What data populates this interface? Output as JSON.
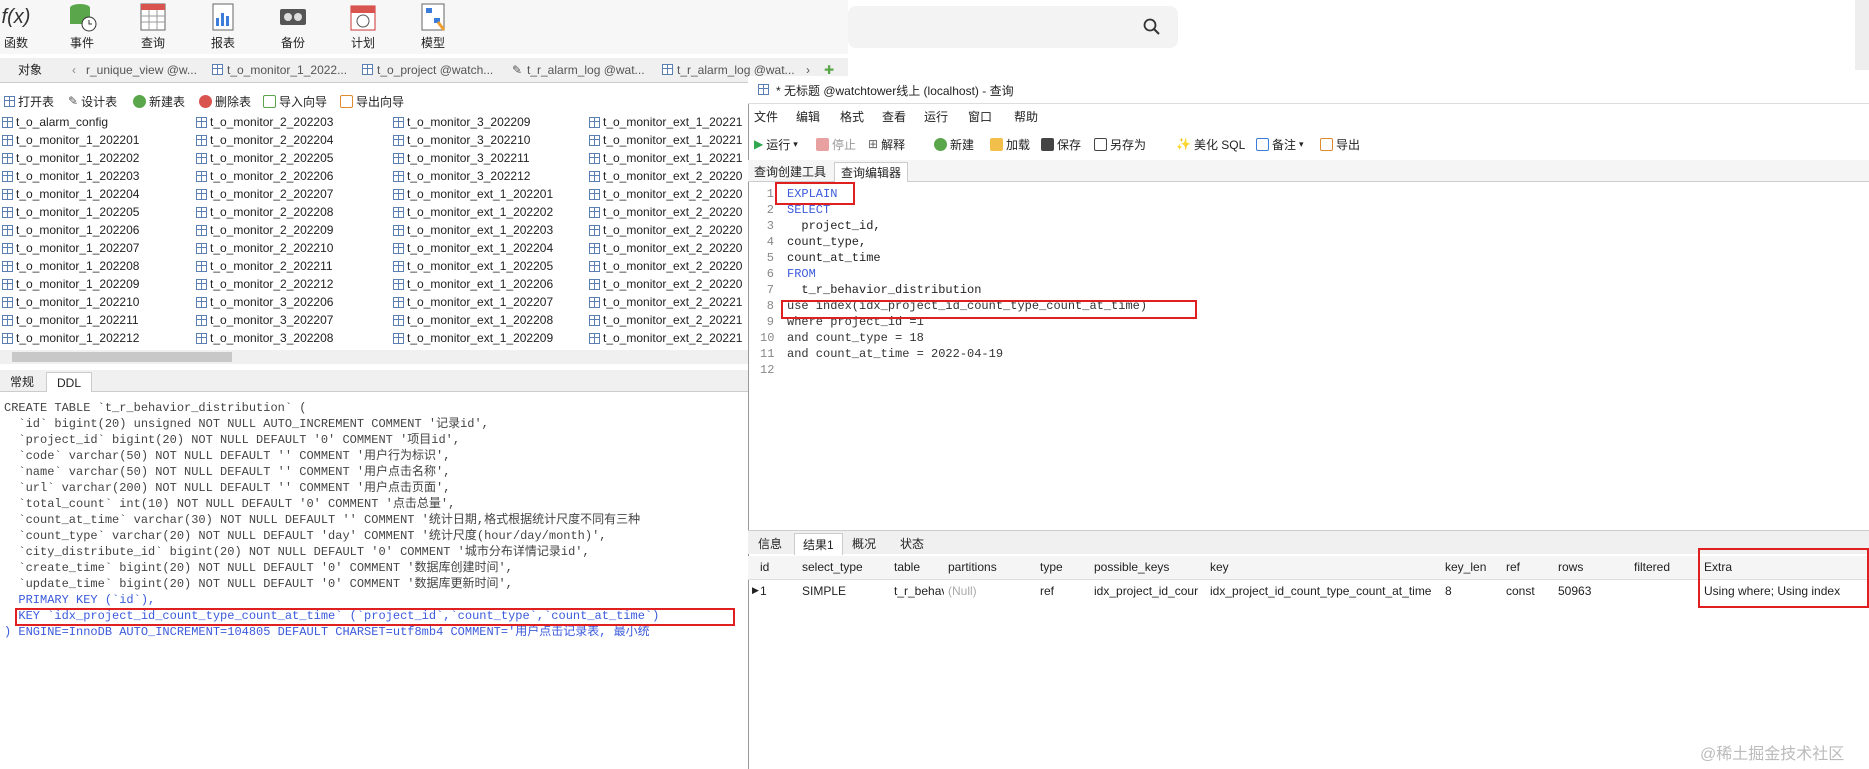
{
  "toolbar": {
    "items": [
      "函数",
      "事件",
      "查询",
      "报表",
      "备份",
      "计划",
      "模型"
    ]
  },
  "left_tabs": {
    "objects": "对象",
    "tabs": [
      "r_unique_view @w...",
      "t_o_monitor_1_2022...",
      "t_o_project @watch...",
      "t_r_alarm_log @wat...",
      "t_r_alarm_log @wat..."
    ]
  },
  "obj_toolbar": [
    "打开表",
    "设计表",
    "新建表",
    "删除表",
    "导入向导",
    "导出向导"
  ],
  "tables": {
    "col1": [
      "t_o_alarm_config",
      "t_o_monitor_1_202201",
      "t_o_monitor_1_202202",
      "t_o_monitor_1_202203",
      "t_o_monitor_1_202204",
      "t_o_monitor_1_202205",
      "t_o_monitor_1_202206",
      "t_o_monitor_1_202207",
      "t_o_monitor_1_202208",
      "t_o_monitor_1_202209",
      "t_o_monitor_1_202210",
      "t_o_monitor_1_202211",
      "t_o_monitor_1_202212"
    ],
    "col2": [
      "t_o_monitor_2_202203",
      "t_o_monitor_2_202204",
      "t_o_monitor_2_202205",
      "t_o_monitor_2_202206",
      "t_o_monitor_2_202207",
      "t_o_monitor_2_202208",
      "t_o_monitor_2_202209",
      "t_o_monitor_2_202210",
      "t_o_monitor_2_202211",
      "t_o_monitor_2_202212",
      "t_o_monitor_3_202206",
      "t_o_monitor_3_202207",
      "t_o_monitor_3_202208"
    ],
    "col3": [
      "t_o_monitor_3_202209",
      "t_o_monitor_3_202210",
      "t_o_monitor_3_202211",
      "t_o_monitor_3_202212",
      "t_o_monitor_ext_1_202201",
      "t_o_monitor_ext_1_202202",
      "t_o_monitor_ext_1_202203",
      "t_o_monitor_ext_1_202204",
      "t_o_monitor_ext_1_202205",
      "t_o_monitor_ext_1_202206",
      "t_o_monitor_ext_1_202207",
      "t_o_monitor_ext_1_202208",
      "t_o_monitor_ext_1_202209"
    ],
    "col4": [
      "t_o_monitor_ext_1_20221",
      "t_o_monitor_ext_1_20221",
      "t_o_monitor_ext_1_20221",
      "t_o_monitor_ext_2_20220",
      "t_o_monitor_ext_2_20220",
      "t_o_monitor_ext_2_20220",
      "t_o_monitor_ext_2_20220",
      "t_o_monitor_ext_2_20220",
      "t_o_monitor_ext_2_20220",
      "t_o_monitor_ext_2_20220",
      "t_o_monitor_ext_2_20221",
      "t_o_monitor_ext_2_20221",
      "t_o_monitor_ext_2_20221"
    ]
  },
  "ddl_tabs": [
    "常规",
    "DDL"
  ],
  "ddl_lines": [
    "CREATE TABLE `t_r_behavior_distribution` (",
    "  `id` bigint(20) unsigned NOT NULL AUTO_INCREMENT COMMENT '记录id',",
    "  `project_id` bigint(20) NOT NULL DEFAULT '0' COMMENT '项目id',",
    "  `code` varchar(50) NOT NULL DEFAULT '' COMMENT '用户行为标识',",
    "  `name` varchar(50) NOT NULL DEFAULT '' COMMENT '用户点击名称',",
    "  `url` varchar(200) NOT NULL DEFAULT '' COMMENT '用户点击页面',",
    "  `total_count` int(10) NOT NULL DEFAULT '0' COMMENT '点击总量',",
    "  `count_at_time` varchar(30) NOT NULL DEFAULT '' COMMENT '统计日期,格式根据统计尺度不同有三种",
    "  `count_type` varchar(20) NOT NULL DEFAULT 'day' COMMENT '统计尺度(hour/day/month)',",
    "  `city_distribute_id` bigint(20) NOT NULL DEFAULT '0' COMMENT '城市分布详情记录id',",
    "  `create_time` bigint(20) NOT NULL DEFAULT '0' COMMENT '数据库创建时间',",
    "  `update_time` bigint(20) NOT NULL DEFAULT '0' COMMENT '数据库更新时间',",
    "  PRIMARY KEY (`id`),",
    "  KEY `idx_project_id_count_type_count_at_time` (`project_id`,`count_type`,`count_at_time`)",
    ") ENGINE=InnoDB AUTO_INCREMENT=104805 DEFAULT CHARSET=utf8mb4 COMMENT='用户点击记录表, 最小统"
  ],
  "query": {
    "title": "* 无标题 @watchtower线上 (localhost) - 查询",
    "menu": [
      "文件",
      "编辑",
      "格式",
      "查看",
      "运行",
      "窗口",
      "帮助"
    ],
    "tools": [
      "运行",
      "停止",
      "解释",
      "新建",
      "加载",
      "保存",
      "另存为",
      "美化 SQL",
      "备注",
      "导出"
    ],
    "subtabs": [
      "查询创建工具",
      "查询编辑器"
    ],
    "code": [
      "EXPLAIN",
      "SELECT",
      "  project_id,",
      "count_type,",
      "count_at_time",
      "FROM",
      "  t_r_behavior_distribution",
      "use index(idx_project_id_count_type_count_at_time)",
      "where project_id =1",
      "and count_type = 18",
      "and count_at_time = 2022-04-19",
      ""
    ],
    "result_tabs": [
      "信息",
      "结果1",
      "概况",
      "状态"
    ],
    "columns": [
      "id",
      "select_type",
      "table",
      "partitions",
      "type",
      "possible_keys",
      "key",
      "key_len",
      "ref",
      "rows",
      "filtered",
      "Extra"
    ],
    "row": [
      "1",
      "SIMPLE",
      "t_r_behavi",
      "(Null)",
      "ref",
      "idx_project_id_cour",
      "idx_project_id_count_type_count_at_time",
      "8",
      "const",
      "50963",
      "",
      "Using where; Using index"
    ]
  },
  "watermark": "@稀土掘金技术社区",
  "colors": {
    "highlight": "#e02020",
    "keyword": "#3b5bdb"
  }
}
